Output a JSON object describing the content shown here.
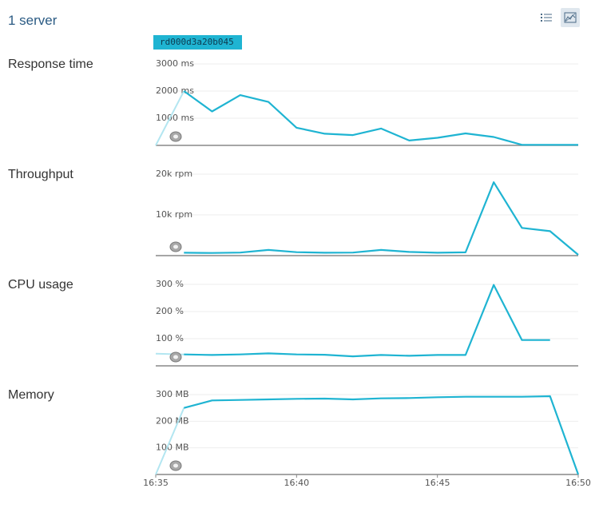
{
  "header": {
    "title": "1 server"
  },
  "view_toggle": {
    "list_icon": "list-icon",
    "chart_icon": "chart-icon",
    "active": "chart"
  },
  "server_tag": "rd000d3a20b045",
  "colors": {
    "series": "#1fb4d2",
    "series_faded": "#b3e6f1",
    "grid": "#eeeeee",
    "axis": "#888888",
    "tick_text": "#555555",
    "title": "#2b5b84"
  },
  "chart_data": [
    {
      "type": "line",
      "title": "Response time",
      "unit": "ms",
      "yticks": [
        1000,
        2000,
        3000
      ],
      "ytick_labels": [
        "1000 ms",
        "2000 ms",
        "3000 ms"
      ],
      "ylim": [
        0,
        3000
      ],
      "xlim": [
        "16:35",
        "16:50"
      ],
      "series": [
        {
          "x": [
            "16:35",
            "16:36",
            "16:37",
            "16:38",
            "16:39",
            "16:40",
            "16:41",
            "16:42",
            "16:43",
            "16:44",
            "16:45",
            "16:46",
            "16:47",
            "16:48",
            "16:49",
            "16:50"
          ],
          "values": [
            0,
            2000,
            1250,
            1850,
            1600,
            650,
            430,
            380,
            620,
            180,
            280,
            440,
            310,
            20,
            20,
            20
          ]
        }
      ]
    },
    {
      "type": "line",
      "title": "Throughput",
      "unit": "rpm",
      "yticks": [
        10000,
        20000
      ],
      "ytick_labels": [
        "10k rpm",
        "20k rpm"
      ],
      "ylim": [
        0,
        20000
      ],
      "xlim": [
        "16:35",
        "16:50"
      ],
      "series": [
        {
          "x": [
            "16:36",
            "16:37",
            "16:38",
            "16:39",
            "16:40",
            "16:41",
            "16:42",
            "16:43",
            "16:44",
            "16:45",
            "16:46",
            "16:47",
            "16:48",
            "16:49",
            "16:50"
          ],
          "values": [
            700,
            650,
            750,
            1400,
            850,
            700,
            750,
            1400,
            900,
            700,
            800,
            18000,
            6800,
            6000,
            200
          ]
        }
      ]
    },
    {
      "type": "line",
      "title": "CPU usage",
      "unit": "%",
      "yticks": [
        100,
        200,
        300
      ],
      "ytick_labels": [
        "100 %",
        "200 %",
        "300 %"
      ],
      "ylim": [
        0,
        300
      ],
      "xlim": [
        "16:35",
        "16:50"
      ],
      "series": [
        {
          "x": [
            "16:35",
            "16:36",
            "16:37",
            "16:38",
            "16:39",
            "16:40",
            "16:41",
            "16:42",
            "16:43",
            "16:44",
            "16:45",
            "16:46",
            "16:47",
            "16:48",
            "16:49"
          ],
          "values": [
            45,
            42,
            40,
            42,
            46,
            42,
            41,
            35,
            40,
            37,
            40,
            40,
            298,
            95,
            95
          ]
        }
      ]
    },
    {
      "type": "line",
      "title": "Memory",
      "unit": "MB",
      "yticks": [
        100,
        200,
        300
      ],
      "ytick_labels": [
        "100 MB",
        "200 MB",
        "300 MB"
      ],
      "ylim": [
        0,
        300
      ],
      "xlim": [
        "16:35",
        "16:50"
      ],
      "xticks": [
        "16:35",
        "16:40",
        "16:45",
        "16:50"
      ],
      "series": [
        {
          "x": [
            "16:35",
            "16:36",
            "16:37",
            "16:38",
            "16:39",
            "16:40",
            "16:41",
            "16:42",
            "16:43",
            "16:44",
            "16:45",
            "16:46",
            "16:47",
            "16:48",
            "16:49",
            "16:50"
          ],
          "values": [
            0,
            250,
            278,
            280,
            282,
            284,
            285,
            282,
            286,
            287,
            290,
            292,
            292,
            292,
            294,
            0
          ]
        }
      ]
    }
  ]
}
